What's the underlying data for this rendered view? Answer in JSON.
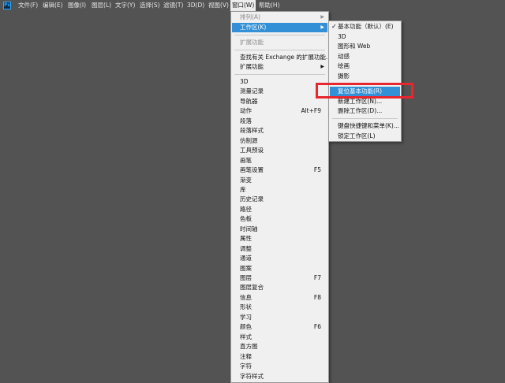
{
  "menubar": {
    "logo": "Ps",
    "items": [
      "文件(F)",
      "编辑(E)",
      "图像(I)",
      "图层(L)",
      "文字(Y)",
      "选择(S)",
      "滤镜(T)",
      "3D(D)",
      "视图(V)",
      "窗口(W)",
      "帮助(H)"
    ]
  },
  "window_menu": {
    "top_items": [
      {
        "label": "排列(A)",
        "disabled": true,
        "submenu": true
      },
      {
        "label": "工作区(K)",
        "highlight": true,
        "submenu": true
      }
    ],
    "ext_items": [
      {
        "label": "扩展功能",
        "disabled": true
      },
      {
        "label": "查找有关 Exchange 的扩展功能...",
        "disabled": false
      },
      {
        "label": "扩展功能",
        "submenu": true
      }
    ],
    "panels": [
      {
        "label": "3D",
        "shortcut": ""
      },
      {
        "label": "测量记录",
        "shortcut": ""
      },
      {
        "label": "导航器",
        "shortcut": ""
      },
      {
        "label": "动作",
        "shortcut": "Alt+F9"
      },
      {
        "label": "段落",
        "shortcut": ""
      },
      {
        "label": "段落样式",
        "shortcut": ""
      },
      {
        "label": "仿制源",
        "shortcut": ""
      },
      {
        "label": "工具预设",
        "shortcut": ""
      },
      {
        "label": "画笔",
        "shortcut": ""
      },
      {
        "label": "画笔设置",
        "shortcut": "F5"
      },
      {
        "label": "渐变",
        "shortcut": ""
      },
      {
        "label": "库",
        "shortcut": ""
      },
      {
        "label": "历史记录",
        "shortcut": ""
      },
      {
        "label": "路径",
        "shortcut": ""
      },
      {
        "label": "色板",
        "shortcut": ""
      },
      {
        "label": "时间轴",
        "shortcut": ""
      },
      {
        "label": "属性",
        "shortcut": ""
      },
      {
        "label": "调整",
        "shortcut": ""
      },
      {
        "label": "通道",
        "shortcut": ""
      },
      {
        "label": "图案",
        "shortcut": ""
      },
      {
        "label": "图层",
        "shortcut": "F7"
      },
      {
        "label": "图层复合",
        "shortcut": ""
      },
      {
        "label": "信息",
        "shortcut": "F8"
      },
      {
        "label": "形状",
        "shortcut": ""
      },
      {
        "label": "学习",
        "shortcut": ""
      },
      {
        "label": "颜色",
        "shortcut": "F6"
      },
      {
        "label": "样式",
        "shortcut": ""
      },
      {
        "label": "直方图",
        "shortcut": ""
      },
      {
        "label": "注释",
        "shortcut": ""
      },
      {
        "label": "字符",
        "shortcut": ""
      },
      {
        "label": "字符样式",
        "shortcut": ""
      }
    ]
  },
  "workspace_submenu": {
    "workspaces": [
      {
        "label": "基本功能（默认）(E)",
        "checked": true
      },
      {
        "label": "3D",
        "checked": false
      },
      {
        "label": "图形和 Web",
        "checked": false
      },
      {
        "label": "动感",
        "checked": false
      },
      {
        "label": "绘画",
        "checked": false
      },
      {
        "label": "摄影",
        "checked": false
      }
    ],
    "actions": [
      {
        "label": "复位基本功能(R)",
        "highlight": true
      },
      {
        "label": "新建工作区(N)...",
        "highlight": false
      },
      {
        "label": "删除工作区(D)...",
        "highlight": false
      }
    ],
    "settings": [
      {
        "label": "键盘快捷键和菜单(K)..."
      },
      {
        "label": "锁定工作区(L)"
      }
    ]
  },
  "colors": {
    "canvas": "#535353",
    "menu_bg": "#f0f0f0",
    "highlight": "#3390d6",
    "annotation_red": "#e8262e"
  }
}
